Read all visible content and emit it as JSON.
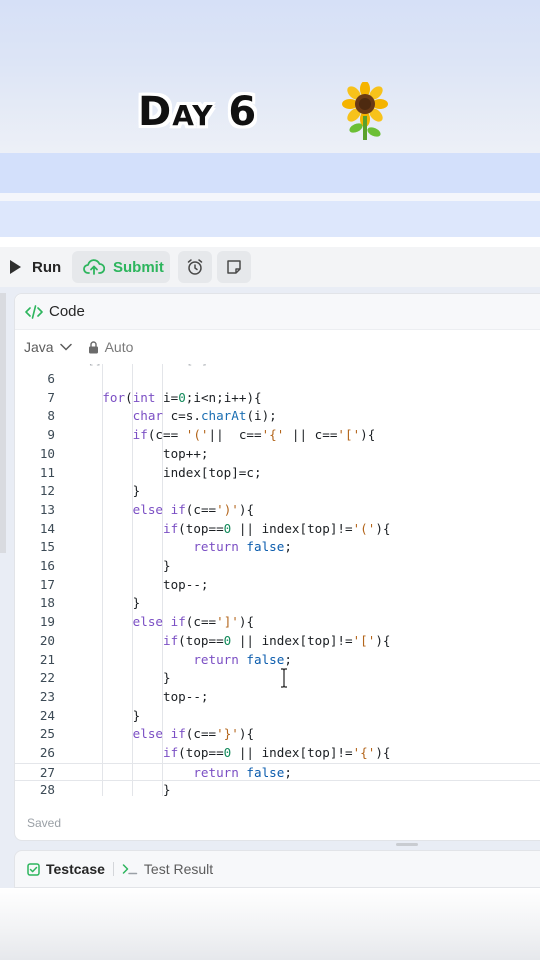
{
  "overlay": {
    "title": "Day 6",
    "emoji": "sunflower"
  },
  "toolbar": {
    "run_label": "Run",
    "submit_label": "Submit",
    "submit_color": "#2db55d"
  },
  "code_panel": {
    "header_label": "Code",
    "language": "Java",
    "mode_label": "Auto",
    "saved_label": "Saved",
    "lines": [
      {
        "n": "6",
        "code": ""
      },
      {
        "n": "7",
        "code": "    for(int i=0;i<n;i++){"
      },
      {
        "n": "8",
        "code": "        char c=s.charAt(i);"
      },
      {
        "n": "9",
        "code": "        if(c== '('||  c=='{' || c=='['){"
      },
      {
        "n": "10",
        "code": "            top++;"
      },
      {
        "n": "11",
        "code": "            index[top]=c;"
      },
      {
        "n": "12",
        "code": "        }"
      },
      {
        "n": "13",
        "code": "        else if(c==')'){"
      },
      {
        "n": "14",
        "code": "            if(top==0 || index[top]!='('){"
      },
      {
        "n": "15",
        "code": "                return false;"
      },
      {
        "n": "16",
        "code": "            }"
      },
      {
        "n": "17",
        "code": "            top--;"
      },
      {
        "n": "18",
        "code": "        }"
      },
      {
        "n": "19",
        "code": "        else if(c==']'){"
      },
      {
        "n": "20",
        "code": "            if(top==0 || index[top]!='['){"
      },
      {
        "n": "21",
        "code": "                return false;"
      },
      {
        "n": "22",
        "code": "            }"
      },
      {
        "n": "23",
        "code": "            top--;"
      },
      {
        "n": "24",
        "code": "        }"
      },
      {
        "n": "25",
        "code": "        else if(c=='}'){"
      },
      {
        "n": "26",
        "code": "            if(top==0 || index[top]!='{'){"
      },
      {
        "n": "27",
        "code": "                return false;"
      },
      {
        "n": "28",
        "code": "            }"
      }
    ],
    "active_line": "27"
  },
  "bottom_tabs": {
    "testcase_label": "Testcase",
    "test_result_label": "Test Result"
  }
}
